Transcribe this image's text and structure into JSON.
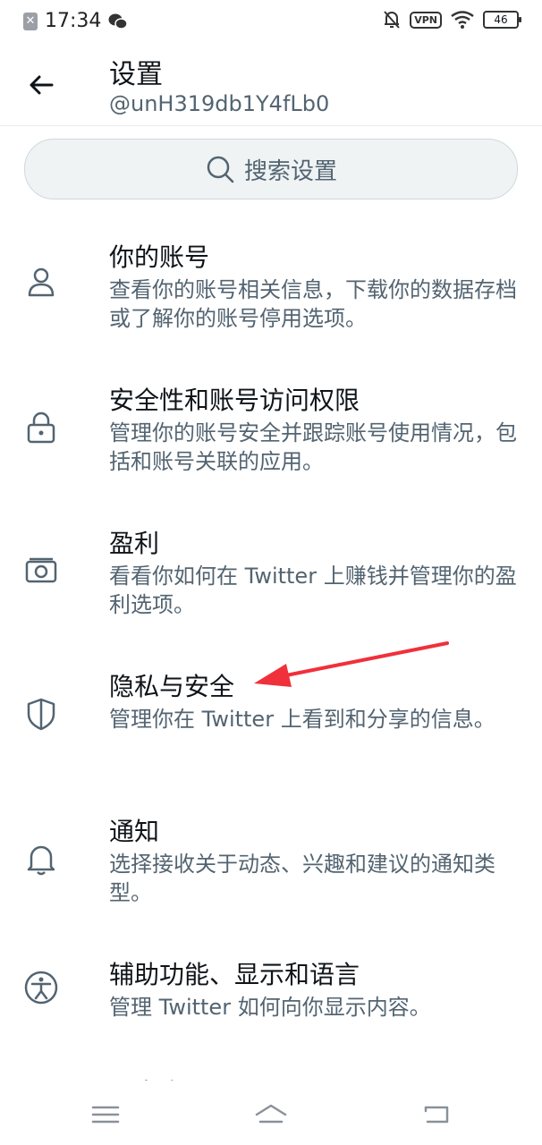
{
  "status_bar": {
    "time": "17:34",
    "vpn": "VPN",
    "battery": "46"
  },
  "header": {
    "title": "设置",
    "handle": "@unH319db1Y4fLb0"
  },
  "search": {
    "label": "搜索设置"
  },
  "items": [
    {
      "title": "你的账号",
      "desc": "查看你的账号相关信息，下载你的数据存档或了解你的账号停用选项。",
      "icon": "person-icon"
    },
    {
      "title": "安全性和账号访问权限",
      "desc": "管理你的账号安全并跟踪账号使用情况，包括和账号关联的应用。",
      "icon": "lock-icon"
    },
    {
      "title": "盈利",
      "desc": "看看你如何在 Twitter 上赚钱并管理你的盈利选项。",
      "icon": "money-icon"
    },
    {
      "title": "隐私与安全",
      "desc": "管理你在 Twitter 上看到和分享的信息。",
      "icon": "shield-icon"
    },
    {
      "title": "通知",
      "desc": "选择接收关于动态、兴趣和建议的通知类型。",
      "icon": "bell-icon"
    },
    {
      "title": "辅助功能、显示和语言",
      "desc": "管理 Twitter 如何向你显示内容。",
      "icon": "accessibility-icon"
    },
    {
      "title": "更多资源",
      "icon": "more-icon"
    }
  ],
  "colors": {
    "annotation_arrow": "#f0303a",
    "secondary_text": "#536471"
  }
}
